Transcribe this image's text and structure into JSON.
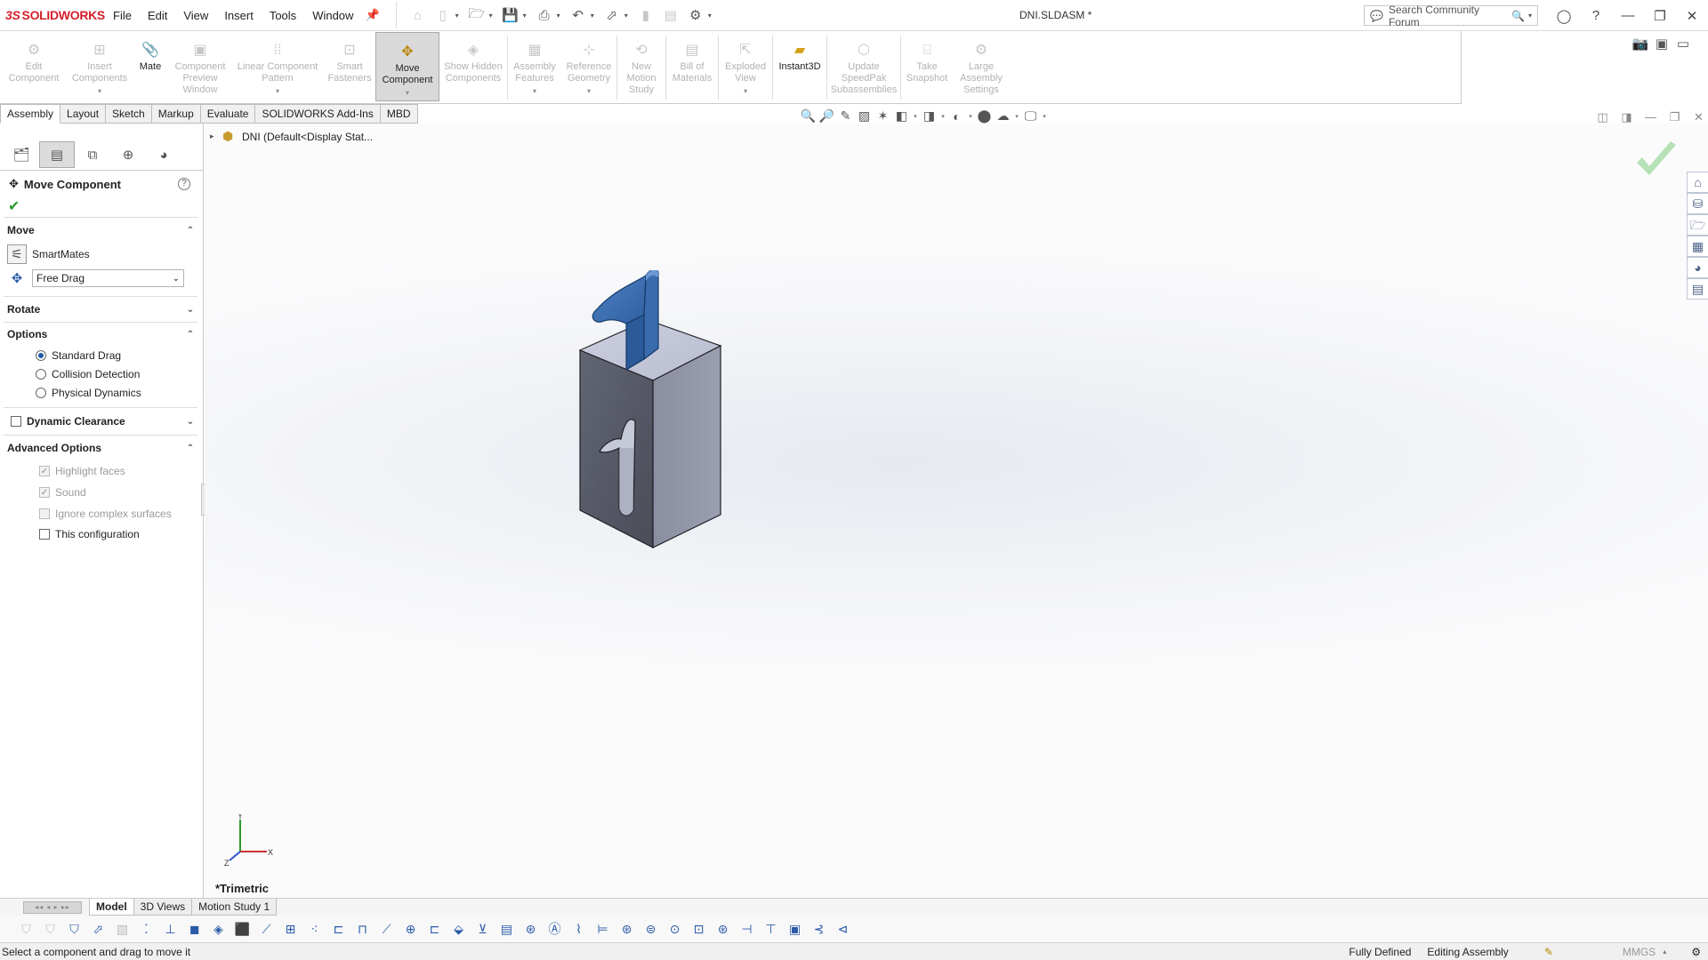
{
  "app": {
    "logo_ds": "3S",
    "logo_name": "SOLIDWORKS",
    "doc_title": "DNI.SLDASM *"
  },
  "menu": [
    "File",
    "Edit",
    "View",
    "Insert",
    "Tools",
    "Window"
  ],
  "search": {
    "placeholder": "Search Community Forum"
  },
  "commands": [
    {
      "label": "Edit Component",
      "icon": "edit-component-icon",
      "enabled": false
    },
    {
      "label": "Insert Components",
      "icon": "insert-components-icon",
      "enabled": false,
      "dropdown": true
    },
    {
      "label": "Mate",
      "icon": "mate-icon",
      "enabled": true
    },
    {
      "label": "Component Preview Window",
      "icon": "component-preview-icon",
      "enabled": false
    },
    {
      "label": "Linear Component Pattern",
      "icon": "linear-pattern-icon",
      "enabled": false,
      "dropdown": true
    },
    {
      "label": "Smart Fasteners",
      "icon": "smart-fasteners-icon",
      "enabled": false
    },
    {
      "label": "Move Component",
      "icon": "move-component-icon",
      "enabled": true,
      "active": true,
      "dropdown": true
    },
    {
      "label": "Show Hidden Components",
      "icon": "show-hidden-icon",
      "enabled": false
    },
    {
      "label": "Assembly Features",
      "icon": "assembly-features-icon",
      "enabled": false,
      "dropdown": true
    },
    {
      "label": "Reference Geometry",
      "icon": "reference-geometry-icon",
      "enabled": false,
      "dropdown": true
    },
    {
      "label": "New Motion Study",
      "icon": "motion-study-icon",
      "enabled": false
    },
    {
      "label": "Bill of Materials",
      "icon": "bom-icon",
      "enabled": false
    },
    {
      "label": "Exploded View",
      "icon": "exploded-view-icon",
      "enabled": false,
      "dropdown": true
    },
    {
      "label": "Instant3D",
      "icon": "instant3d-icon",
      "enabled": true
    },
    {
      "label": "Update SpeedPak Subassemblies",
      "icon": "speedpak-icon",
      "enabled": false
    },
    {
      "label": "Take Snapshot",
      "icon": "snapshot-icon",
      "enabled": false
    },
    {
      "label": "Large Assembly Settings",
      "icon": "large-assembly-icon",
      "enabled": false
    }
  ],
  "tabs": [
    "Assembly",
    "Layout",
    "Sketch",
    "Markup",
    "Evaluate",
    "SOLIDWORKS Add-Ins",
    "MBD"
  ],
  "active_tab": "Assembly",
  "property_manager": {
    "title": "Move Component",
    "move": {
      "header": "Move",
      "smartmates_label": "SmartMates",
      "drag_mode": "Free Drag"
    },
    "rotate": {
      "header": "Rotate"
    },
    "options": {
      "header": "Options",
      "standard_drag": "Standard Drag",
      "collision_detection": "Collision Detection",
      "physical_dynamics": "Physical Dynamics",
      "selected": "Standard Drag"
    },
    "dynamic_clearance": {
      "header": "Dynamic Clearance"
    },
    "advanced": {
      "header": "Advanced Options",
      "highlight_faces": "Highlight faces",
      "sound": "Sound",
      "ignore_complex": "Ignore complex surfaces",
      "this_configuration": "This configuration"
    }
  },
  "tree": {
    "root_label": "DNI  (Default<Display Stat..."
  },
  "viewport": {
    "view_name": "*Trimetric"
  },
  "bottom_tabs": [
    "Model",
    "3D Views",
    "Motion Study 1"
  ],
  "active_bottom_tab": "Model",
  "status": {
    "message": "Select a component and drag to move it",
    "defined": "Fully Defined",
    "mode": "Editing Assembly",
    "units": "MMGS"
  },
  "colors": {
    "brand": "#d51f2a",
    "part_blue": "#3a6bad",
    "block_face_front": "#5a5d68",
    "confirm_green": "#8fd08f"
  }
}
